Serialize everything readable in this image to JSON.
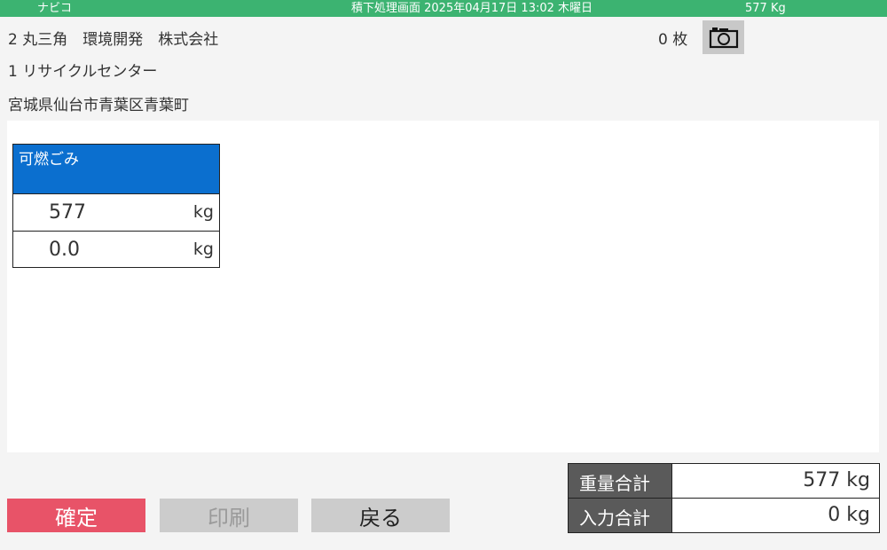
{
  "status_bar": {
    "app_name": "ナビコ",
    "screen_title": "積下処理画面  2025年04月17日 13:02 木曜日",
    "weight": "577  Kg"
  },
  "header": {
    "customer": "2 丸三角　環境開発　株式会社",
    "site": "1 リサイクルセンター",
    "address": "宮城県仙台市青葉区青葉町",
    "photo_count": "0 枚",
    "camera_icon": "camera-icon"
  },
  "item": {
    "category": "可燃ごみ",
    "weight_value": "577",
    "weight_unit": "kg",
    "input_value": "0.0",
    "input_unit": "kg",
    "header_color": "#0b6fcf"
  },
  "buttons": {
    "confirm": "確定",
    "print": "印刷",
    "back": "戻る"
  },
  "totals": {
    "weight_label": "重量合計",
    "weight_value": "577 kg",
    "input_label": "入力合計",
    "input_value": "0 kg"
  },
  "colors": {
    "status_bar": "#3cb371",
    "confirm": "#e85368",
    "disabled": "#cccccc"
  }
}
